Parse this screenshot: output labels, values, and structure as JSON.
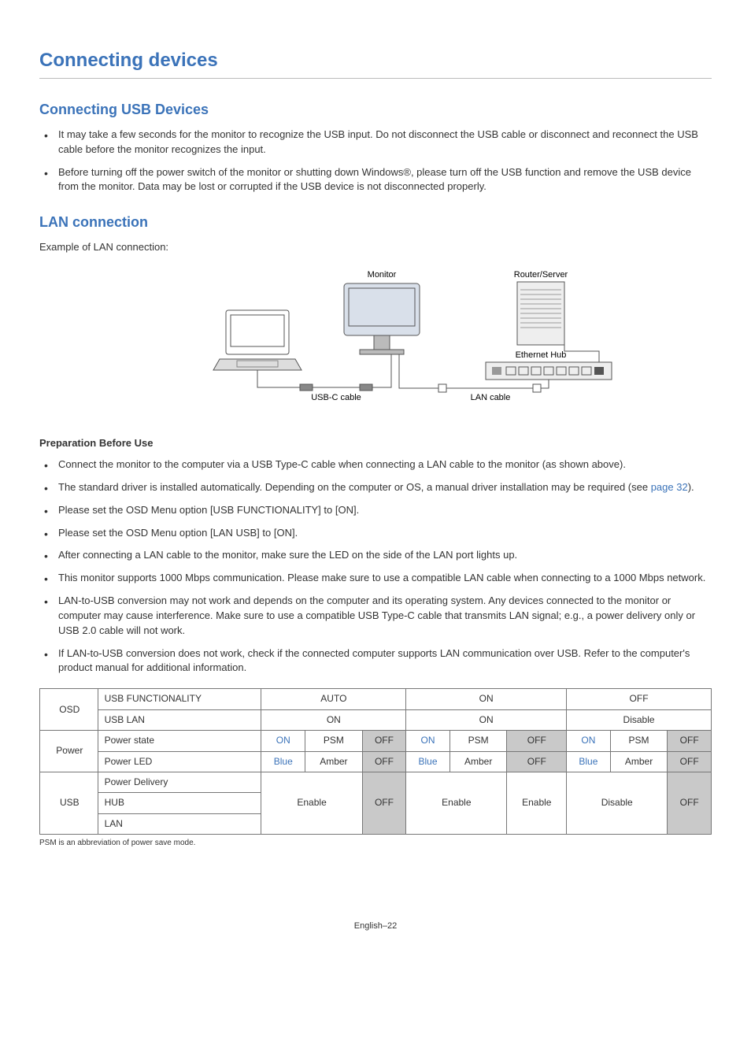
{
  "page_title": "Connecting devices",
  "sections": {
    "usb": {
      "heading": "Connecting USB Devices",
      "bullets": [
        "It may take a few seconds for the monitor to recognize the USB input. Do not disconnect the USB cable or disconnect and reconnect the USB cable before the monitor recognizes the input.",
        "Before turning off the power switch of the monitor or shutting down Windows®, please turn off the USB function and remove the USB device from the monitor. Data may be lost or corrupted if the USB device is not disconnected properly."
      ]
    },
    "lan": {
      "heading": "LAN connection",
      "intro": "Example of LAN connection:",
      "diagram": {
        "monitor": "Monitor",
        "router": "Router/Server",
        "ehub": "Ethernet Hub",
        "usbc": "USB-C cable",
        "lancable": "LAN cable"
      },
      "prep_heading": "Preparation Before Use",
      "prep_bullets_a": "Connect the monitor to the computer via a USB Type-C cable when connecting a LAN cable to the monitor (as shown above).",
      "prep_bullets_b_pre": "The standard driver is installed automatically. Depending on the computer or OS, a manual driver installation may be required (see ",
      "prep_bullets_b_link": "page 32",
      "prep_bullets_b_post": ").",
      "prep_bullets_c": "Please set the OSD Menu option [USB FUNCTIONALITY] to [ON].",
      "prep_bullets_d": "Please set the OSD Menu option [LAN USB] to [ON].",
      "prep_bullets_e": "After connecting a LAN cable to the monitor, make sure the LED on the side of the LAN port lights up.",
      "prep_bullets_f": "This monitor supports 1000 Mbps communication. Please make sure to use a compatible LAN cable when connecting to a 1000 Mbps network.",
      "prep_bullets_g": "LAN-to-USB conversion may not work and depends on the computer and its operating system. Any devices connected to the monitor or computer may cause interference. Make sure to use a compatible USB Type-C cable that transmits LAN signal; e.g., a power delivery only or USB 2.0 cable will not work.",
      "prep_bullets_h": "If LAN-to-USB conversion does not work, check if the connected computer supports LAN communication over USB. Refer to the computer's product manual for additional information."
    }
  },
  "table": {
    "row_labels": {
      "osd": "OSD",
      "usb_func": "USB FUNCTIONALITY",
      "usb_lan": "USB LAN",
      "power": "Power",
      "power_state": "Power state",
      "power_led": "Power LED",
      "usb": "USB",
      "pd": "Power Delivery",
      "hub": "HUB",
      "lan": "LAN"
    },
    "groups": {
      "auto": "AUTO",
      "on": "ON",
      "off_h": "OFF",
      "disable": "Disable",
      "on_sub": "ON"
    },
    "vals": {
      "on": "ON",
      "psm": "PSM",
      "off": "OFF",
      "blue": "Blue",
      "amber": "Amber",
      "enable": "Enable",
      "disable": "Disable"
    }
  },
  "footnote": "PSM is an abbreviation of power save mode.",
  "footer": "English–22"
}
